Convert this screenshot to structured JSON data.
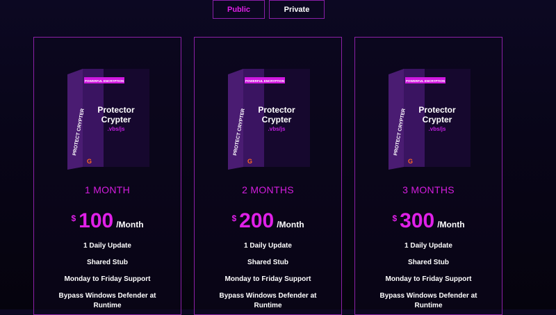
{
  "tabs": [
    {
      "label": "Public",
      "active": true
    },
    {
      "label": "Private",
      "active": false
    }
  ],
  "product": {
    "badge": "POWERFUL ENCRYPTION",
    "title_line1": "Protector",
    "title_line2": "Crypter",
    "subtitle": ".vbs/js",
    "side_text": "PROTECT CRYPTER",
    "logo": "G"
  },
  "plans": [
    {
      "name": "1 MONTH",
      "currency": "$",
      "price": "100",
      "period": "/Month",
      "features": [
        "1 Daily Update",
        "Shared Stub",
        "Monday to Friday Support",
        "Bypass Windows Defender at Runtime"
      ]
    },
    {
      "name": "2 MONTHS",
      "currency": "$",
      "price": "200",
      "period": "/Month",
      "features": [
        "1 Daily Update",
        "Shared Stub",
        "Monday to Friday Support",
        "Bypass Windows Defender at Runtime"
      ]
    },
    {
      "name": "3 MONTHS",
      "currency": "$",
      "price": "300",
      "period": "/Month",
      "features": [
        "1 Daily Update",
        "Shared Stub",
        "Monday to Friday Support",
        "Bypass Windows Defender at Runtime"
      ]
    }
  ],
  "colors": {
    "accent": "#e020e8",
    "border": "#8c20a6",
    "background": "#0a0720"
  }
}
